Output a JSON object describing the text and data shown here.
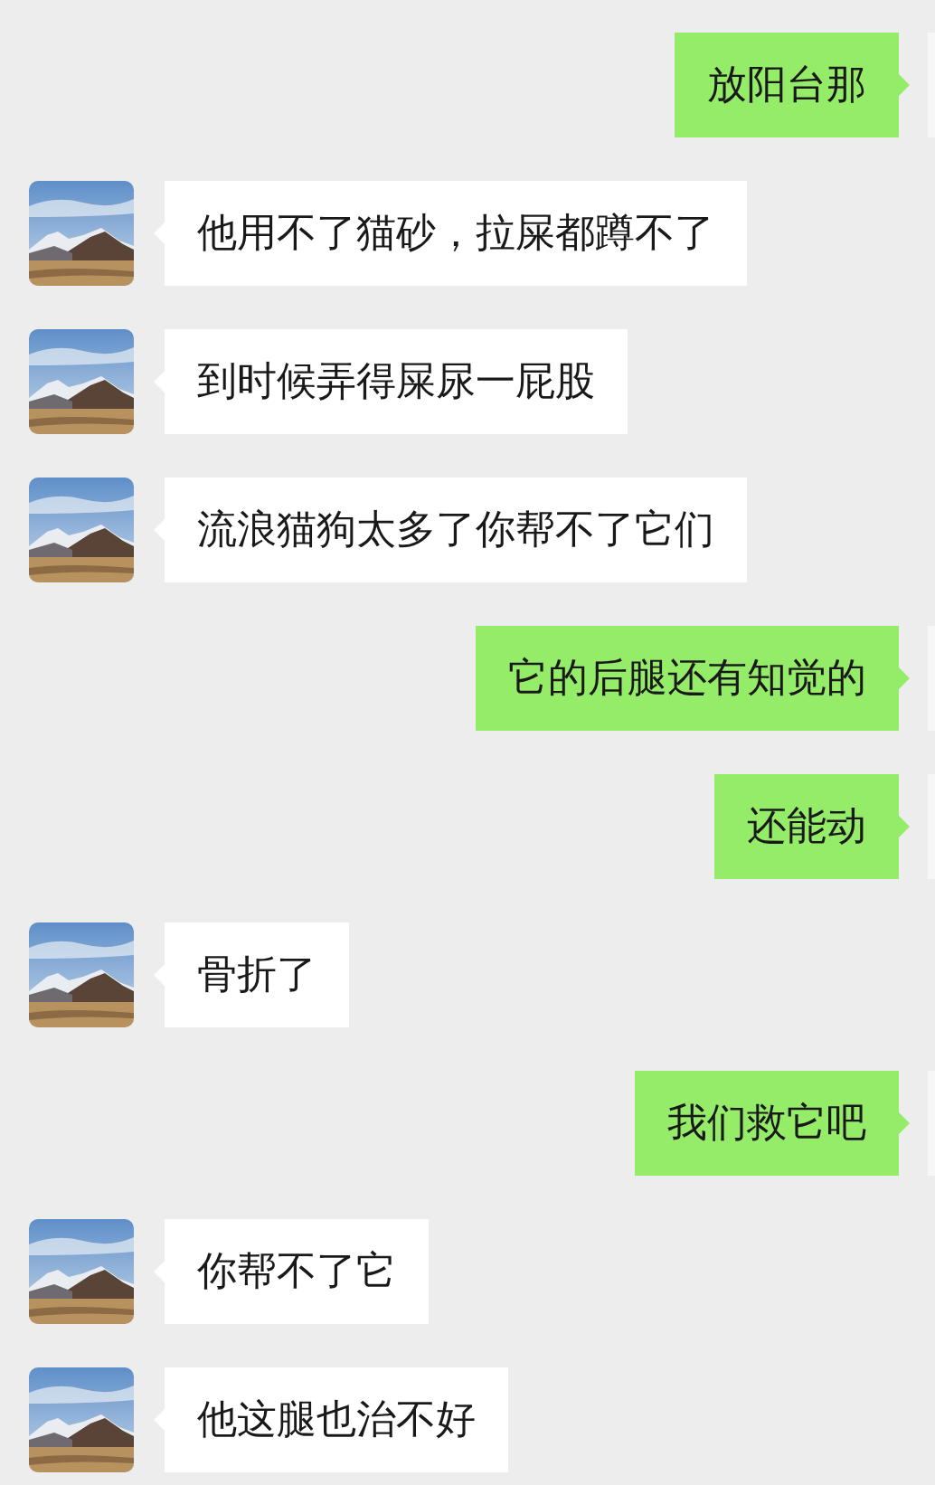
{
  "messages": [
    {
      "kind": "outgoing",
      "text": "放阳台那"
    },
    {
      "kind": "incoming",
      "text": "他用不了猫砂，拉屎都蹲不了"
    },
    {
      "kind": "incoming",
      "text": "到时候弄得屎尿一屁股"
    },
    {
      "kind": "incoming",
      "text": "流浪猫狗太多了你帮不了它们"
    },
    {
      "kind": "outgoing",
      "text": "它的后腿还有知觉的"
    },
    {
      "kind": "outgoing",
      "text": "还能动"
    },
    {
      "kind": "incoming",
      "text": "骨折了"
    },
    {
      "kind": "outgoing",
      "text": "我们救它吧"
    },
    {
      "kind": "incoming",
      "text": "你帮不了它"
    },
    {
      "kind": "incoming",
      "text": "他这腿也治不好"
    }
  ]
}
